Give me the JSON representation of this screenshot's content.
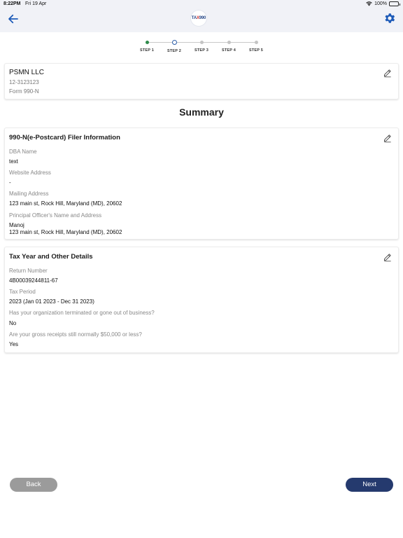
{
  "status_bar": {
    "time": "8:22PM",
    "date": "Fri 19 Apr",
    "battery": "100%"
  },
  "header": {
    "logo_prefix": "TA",
    "logo_x": "X",
    "logo_suffix": "990",
    "icons": {
      "back": "back-arrow-icon",
      "settings": "gear-icon"
    },
    "accent_color": "#1e5bb8"
  },
  "stepper": {
    "steps": [
      {
        "label": "STEP 1",
        "state": "done"
      },
      {
        "label": "STEP 2",
        "state": "current"
      },
      {
        "label": "STEP 3",
        "state": "pending"
      },
      {
        "label": "STEP 4",
        "state": "pending"
      },
      {
        "label": "STEP 5",
        "state": "pending"
      }
    ],
    "colors": {
      "done": "#2e8b4a",
      "current": "#2a5ca8",
      "pending": "#c4c4c4"
    }
  },
  "organization": {
    "name": "PSMN LLC",
    "ein": "12-3123123",
    "form": "Form 990-N"
  },
  "summary_title": "Summary",
  "filer_info": {
    "title": "990-N(e-Postcard) Filer Information",
    "fields": [
      {
        "label": "DBA Name",
        "value": "text"
      },
      {
        "label": "Website Address",
        "value": "-"
      },
      {
        "label": "Mailing Address",
        "value": "123 main st, Rock Hill, Maryland (MD), 20602"
      },
      {
        "label": "Principal Officer's Name and Address",
        "value": "Manoj",
        "value2": "123 main st, Rock Hill, Maryland (MD), 20602"
      }
    ]
  },
  "tax_details": {
    "title": "Tax Year and Other Details",
    "fields": [
      {
        "label": "Return Number",
        "value": "4B00039244811-67"
      },
      {
        "label": "Tax Period",
        "value": "2023 (Jan 01 2023 - Dec 31 2023)"
      },
      {
        "label": "Has your organization terminated or gone out of business?",
        "value": "No"
      },
      {
        "label": "Are your gross receipts still normally $50,000 or less?",
        "value": "Yes"
      }
    ]
  },
  "buttons": {
    "back": "Back",
    "next": "Next",
    "back_color": "#9b9b9b",
    "next_color": "#253a6e"
  }
}
